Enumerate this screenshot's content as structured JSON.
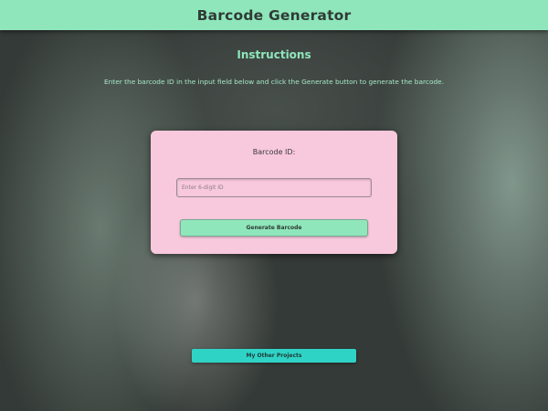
{
  "header": {
    "title": "Barcode Generator"
  },
  "instructions": {
    "title": "Instructions",
    "text": "Enter the barcode ID in the input field below and click the Generate button to generate the barcode."
  },
  "form": {
    "label": "Barcode ID:",
    "input_value": "",
    "input_placeholder": "Enter 6-digit ID",
    "generate_label": "Generate Barcode"
  },
  "footer": {
    "projects_label": "My Other Projects"
  },
  "colors": {
    "header_bg": "#8fe6bb",
    "card_bg": "#f8c8dc",
    "accent_teal": "#2fd3c6",
    "background": "#343a37"
  }
}
